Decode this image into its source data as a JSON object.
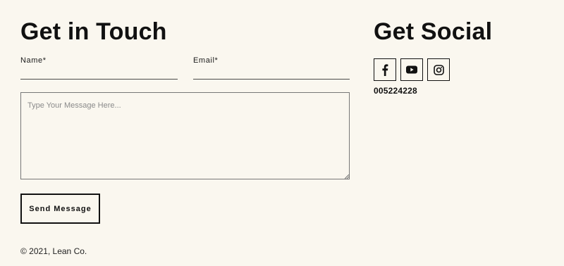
{
  "contact": {
    "heading": "Get in Touch",
    "name_label": "Name*",
    "name_value": "",
    "email_label": "Email*",
    "email_value": "",
    "message_placeholder": "Type Your Message Here...",
    "send_label": "Send Message"
  },
  "social": {
    "heading": "Get Social",
    "icons": [
      {
        "name": "facebook-icon"
      },
      {
        "name": "youtube-icon"
      },
      {
        "name": "instagram-icon"
      }
    ],
    "phone": "005224228"
  },
  "footer": {
    "copyright": "© 2021, Lean Co."
  },
  "colors": {
    "background": "#faf7ef",
    "text": "#111111"
  }
}
